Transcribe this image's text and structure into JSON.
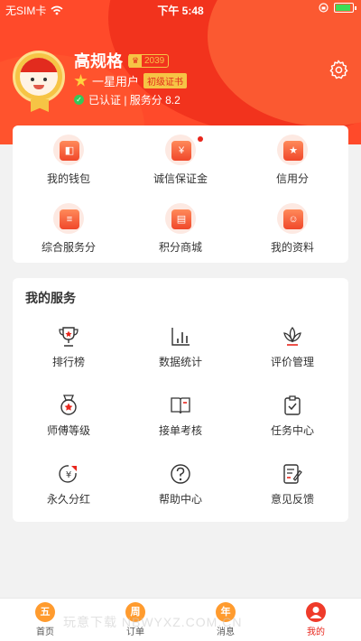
{
  "status_bar": {
    "carrier": "无SIM卡",
    "time": "下午 5:48"
  },
  "profile": {
    "name": "高规格",
    "level_number": "2039",
    "rank": "一星用户",
    "cert_badge": "初级证书",
    "auth_text": "已认证 | 服务分 8.2"
  },
  "quick_grid": [
    {
      "label": "我的钱包",
      "icon": "wallet-icon",
      "glyph": "◧"
    },
    {
      "label": "诚信保证金",
      "icon": "deposit-icon",
      "glyph": "¥"
    },
    {
      "label": "信用分",
      "icon": "credit-icon",
      "glyph": "★"
    },
    {
      "label": "综合服务分",
      "icon": "service-score-icon",
      "glyph": "≡"
    },
    {
      "label": "积分商城",
      "icon": "points-mall-icon",
      "glyph": "▤"
    },
    {
      "label": "我的资料",
      "icon": "profile-icon",
      "glyph": "☺"
    }
  ],
  "services": {
    "title": "我的服务",
    "items": [
      {
        "label": "排行榜",
        "icon": "trophy-icon"
      },
      {
        "label": "数据统计",
        "icon": "bar-chart-icon"
      },
      {
        "label": "评价管理",
        "icon": "lotus-icon"
      },
      {
        "label": "师傅等级",
        "icon": "medal-icon"
      },
      {
        "label": "接单考核",
        "icon": "book-icon"
      },
      {
        "label": "任务中心",
        "icon": "clipboard-icon"
      },
      {
        "label": "永久分红",
        "icon": "dividend-icon"
      },
      {
        "label": "帮助中心",
        "icon": "help-icon"
      },
      {
        "label": "意见反馈",
        "icon": "feedback-icon"
      }
    ]
  },
  "tabbar": {
    "tabs": [
      {
        "label": "首页",
        "glyph": "五"
      },
      {
        "label": "订单",
        "glyph": "周"
      },
      {
        "label": "消息",
        "glyph": "年"
      },
      {
        "label": "我的",
        "glyph": ""
      }
    ],
    "watermark": "玩意下载 NBWYXZ.COM.CN"
  },
  "colors": {
    "brand_red": "#ef3b2a",
    "hero_bg": "#ff4a2a",
    "gold": "#f6c445"
  }
}
